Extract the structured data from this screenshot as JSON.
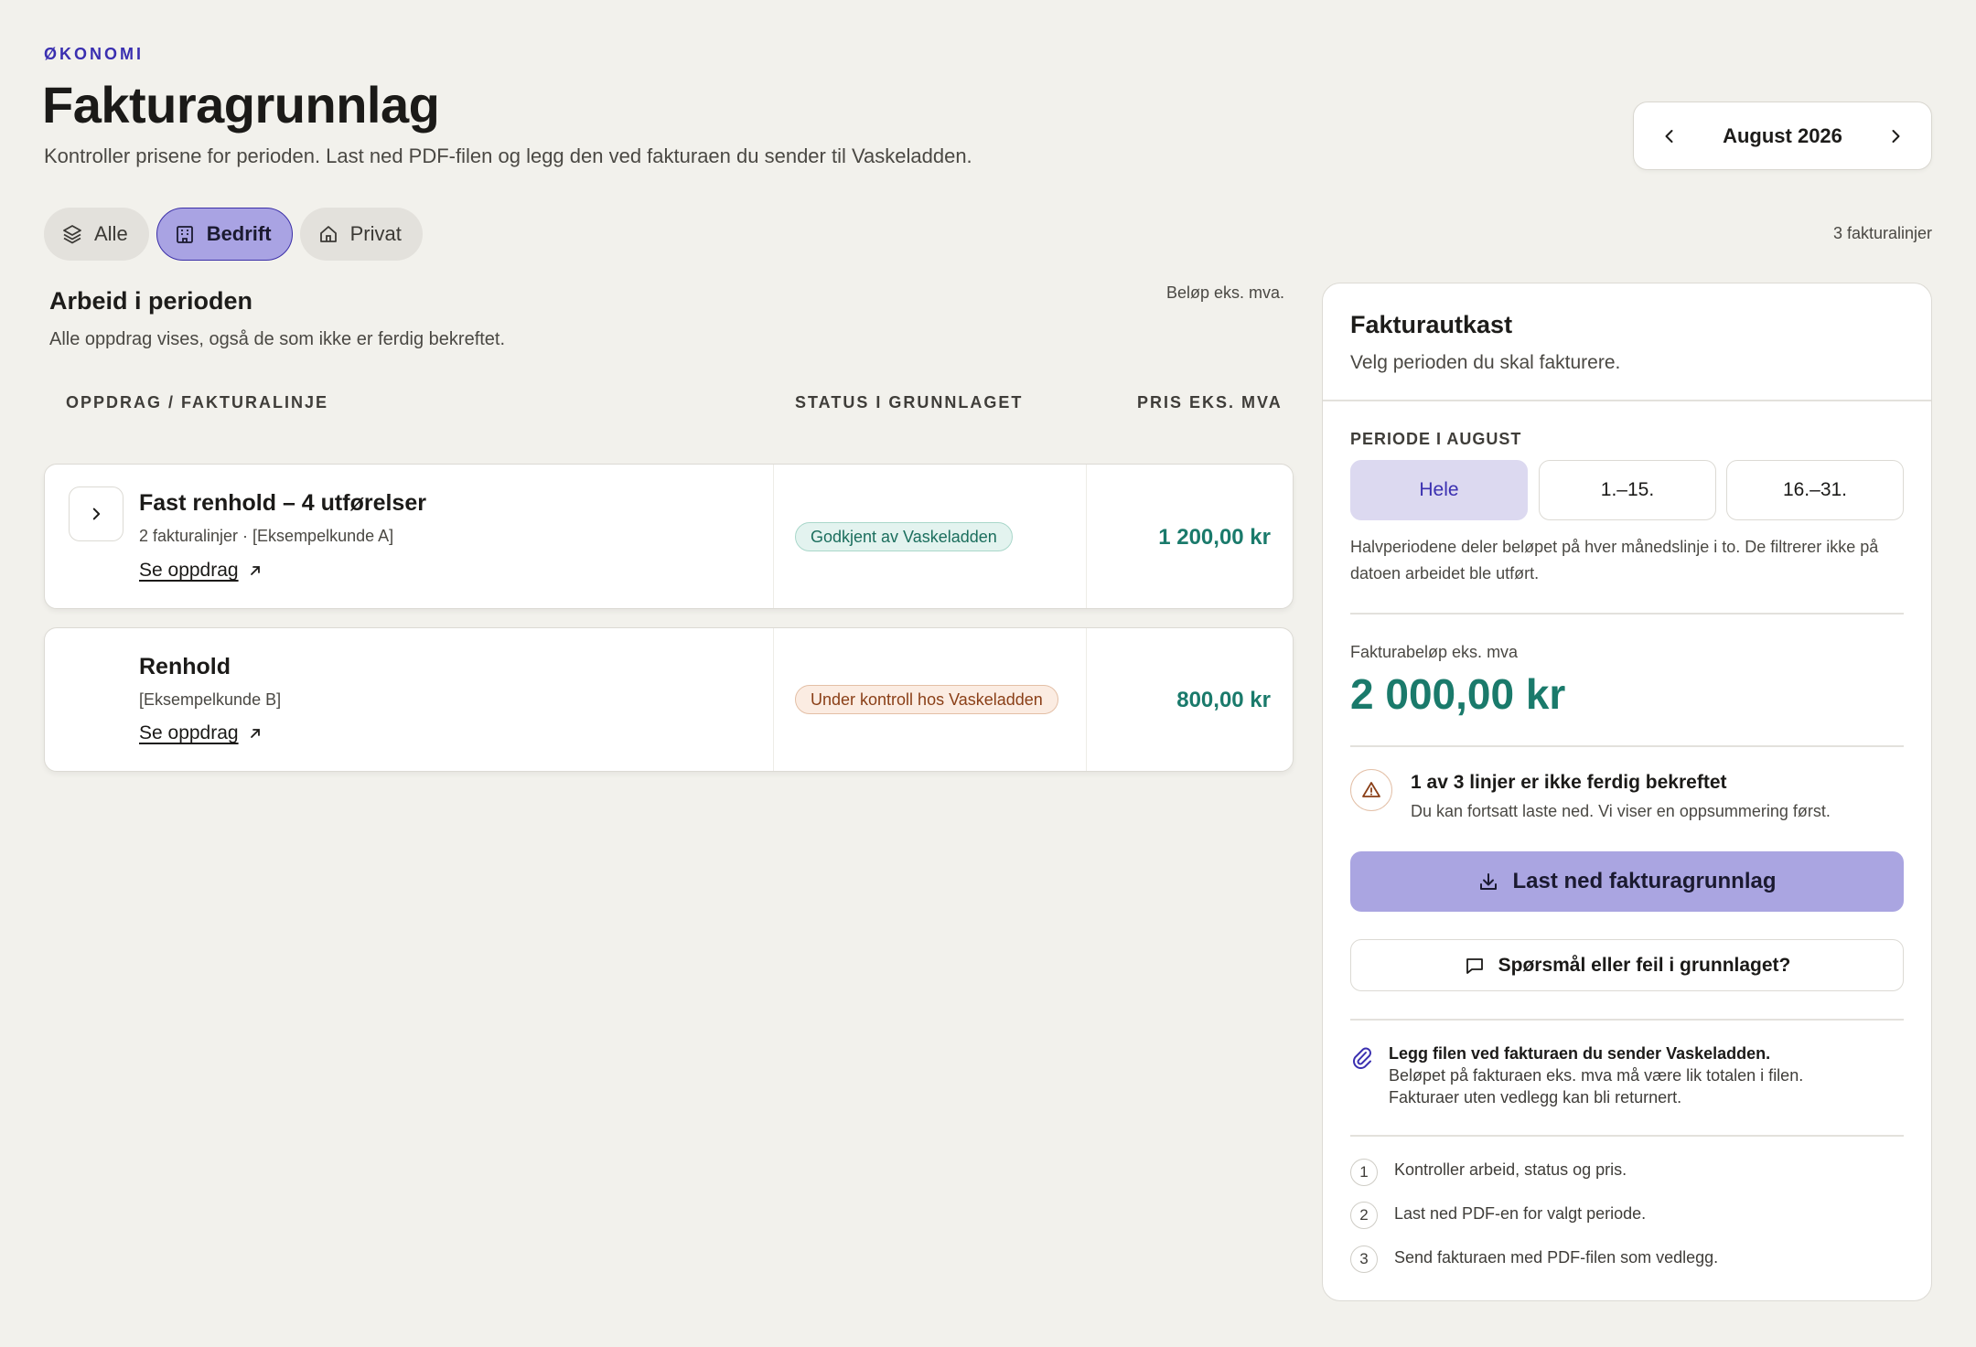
{
  "header": {
    "eyebrow": "ØKONOMI",
    "title": "Fakturagrunnlag",
    "subtitle": "Kontroller prisene for perioden. Last ned PDF-filen og legg den ved fakturaen du sender til Vaskeladden.",
    "period": "August 2026"
  },
  "filters": {
    "items": [
      {
        "label": "Alle",
        "icon": "layers-icon",
        "active": false
      },
      {
        "label": "Bedrift",
        "icon": "building-icon",
        "active": true
      },
      {
        "label": "Privat",
        "icon": "home-icon",
        "active": false
      }
    ],
    "line_count": "3 fakturalinjer"
  },
  "work": {
    "title": "Arbeid i perioden",
    "subtitle": "Alle oppdrag vises, også de som ikke er ferdig bekreftet.",
    "note": "Beløp eks. mva.",
    "columns": [
      "OPPDRAG / FAKTURALINJE",
      "STATUS I GRUNNLAGET",
      "PRIS EKS. MVA"
    ],
    "rows": [
      {
        "title": "Fast renhold – 4 utførelser",
        "meta": "2 fakturalinjer · [Eksempelkunde A]",
        "link": "Se oppdrag",
        "status": "Godkjent av Vaskeladden",
        "price": "1 200,00 kr",
        "expandable": true
      },
      {
        "title": "Renhold",
        "meta": "[Eksempelkunde B]",
        "link": "Se oppdrag",
        "status": "Under kontroll hos Vaskeladden",
        "price": "800,00 kr",
        "expandable": false
      }
    ]
  },
  "panel": {
    "title": "Fakturautkast",
    "subtitle": "Velg perioden du skal fakturere.",
    "period_label": "PERIODE I AUGUST",
    "segments": [
      "Hele",
      "1.–15.",
      "16.–31."
    ],
    "active_segment": "Hele",
    "help": "Halvperiodene deler beløpet på hver månedslinje i to. De filtrerer ikke på datoen arbeidet ble utført.",
    "amount_label": "Fakturabeløp eks. mva",
    "amount": "2 000,00 kr",
    "warning_title": "1 av 3 linjer er ikke ferdig bekreftet",
    "warning_sub": "Du kan fortsatt laste ned. Vi viser en oppsummering først.",
    "download_label": "Last ned fakturagrunnlag",
    "question_label": "Spørsmål eller feil i grunnlaget?",
    "attach_title": "Legg filen ved fakturaen du sender Vaskeladden.",
    "attach_line1": "Beløpet på fakturaen eks. mva må være lik totalen i filen.",
    "attach_line2": "Fakturaer uten vedlegg kan bli returnert.",
    "steps": [
      {
        "num": "1",
        "text": "Kontroller arbeid, status og pris."
      },
      {
        "num": "2",
        "text": "Last ned PDF-en for valgt periode."
      },
      {
        "num": "3",
        "text": "Send fakturaen med PDF-filen som vedlegg."
      }
    ]
  },
  "colors": {
    "accent": "#3a2fb0",
    "primary_button": "#aaa5e1",
    "price": "#1a7a6b",
    "background": "#f2f1ec"
  }
}
